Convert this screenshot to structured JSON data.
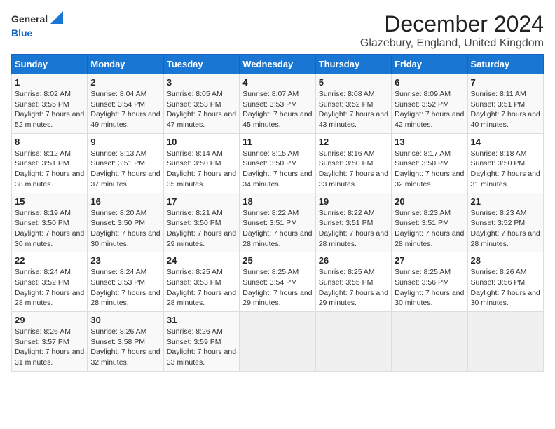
{
  "header": {
    "logo_general": "General",
    "logo_blue": "Blue",
    "title": "December 2024",
    "subtitle": "Glazebury, England, United Kingdom"
  },
  "calendar": {
    "columns": [
      "Sunday",
      "Monday",
      "Tuesday",
      "Wednesday",
      "Thursday",
      "Friday",
      "Saturday"
    ],
    "rows": [
      [
        {
          "day": "1",
          "sunrise": "Sunrise: 8:02 AM",
          "sunset": "Sunset: 3:55 PM",
          "daylight": "Daylight: 7 hours and 52 minutes."
        },
        {
          "day": "2",
          "sunrise": "Sunrise: 8:04 AM",
          "sunset": "Sunset: 3:54 PM",
          "daylight": "Daylight: 7 hours and 49 minutes."
        },
        {
          "day": "3",
          "sunrise": "Sunrise: 8:05 AM",
          "sunset": "Sunset: 3:53 PM",
          "daylight": "Daylight: 7 hours and 47 minutes."
        },
        {
          "day": "4",
          "sunrise": "Sunrise: 8:07 AM",
          "sunset": "Sunset: 3:53 PM",
          "daylight": "Daylight: 7 hours and 45 minutes."
        },
        {
          "day": "5",
          "sunrise": "Sunrise: 8:08 AM",
          "sunset": "Sunset: 3:52 PM",
          "daylight": "Daylight: 7 hours and 43 minutes."
        },
        {
          "day": "6",
          "sunrise": "Sunrise: 8:09 AM",
          "sunset": "Sunset: 3:52 PM",
          "daylight": "Daylight: 7 hours and 42 minutes."
        },
        {
          "day": "7",
          "sunrise": "Sunrise: 8:11 AM",
          "sunset": "Sunset: 3:51 PM",
          "daylight": "Daylight: 7 hours and 40 minutes."
        }
      ],
      [
        {
          "day": "8",
          "sunrise": "Sunrise: 8:12 AM",
          "sunset": "Sunset: 3:51 PM",
          "daylight": "Daylight: 7 hours and 38 minutes."
        },
        {
          "day": "9",
          "sunrise": "Sunrise: 8:13 AM",
          "sunset": "Sunset: 3:51 PM",
          "daylight": "Daylight: 7 hours and 37 minutes."
        },
        {
          "day": "10",
          "sunrise": "Sunrise: 8:14 AM",
          "sunset": "Sunset: 3:50 PM",
          "daylight": "Daylight: 7 hours and 35 minutes."
        },
        {
          "day": "11",
          "sunrise": "Sunrise: 8:15 AM",
          "sunset": "Sunset: 3:50 PM",
          "daylight": "Daylight: 7 hours and 34 minutes."
        },
        {
          "day": "12",
          "sunrise": "Sunrise: 8:16 AM",
          "sunset": "Sunset: 3:50 PM",
          "daylight": "Daylight: 7 hours and 33 minutes."
        },
        {
          "day": "13",
          "sunrise": "Sunrise: 8:17 AM",
          "sunset": "Sunset: 3:50 PM",
          "daylight": "Daylight: 7 hours and 32 minutes."
        },
        {
          "day": "14",
          "sunrise": "Sunrise: 8:18 AM",
          "sunset": "Sunset: 3:50 PM",
          "daylight": "Daylight: 7 hours and 31 minutes."
        }
      ],
      [
        {
          "day": "15",
          "sunrise": "Sunrise: 8:19 AM",
          "sunset": "Sunset: 3:50 PM",
          "daylight": "Daylight: 7 hours and 30 minutes."
        },
        {
          "day": "16",
          "sunrise": "Sunrise: 8:20 AM",
          "sunset": "Sunset: 3:50 PM",
          "daylight": "Daylight: 7 hours and 30 minutes."
        },
        {
          "day": "17",
          "sunrise": "Sunrise: 8:21 AM",
          "sunset": "Sunset: 3:50 PM",
          "daylight": "Daylight: 7 hours and 29 minutes."
        },
        {
          "day": "18",
          "sunrise": "Sunrise: 8:22 AM",
          "sunset": "Sunset: 3:51 PM",
          "daylight": "Daylight: 7 hours and 28 minutes."
        },
        {
          "day": "19",
          "sunrise": "Sunrise: 8:22 AM",
          "sunset": "Sunset: 3:51 PM",
          "daylight": "Daylight: 7 hours and 28 minutes."
        },
        {
          "day": "20",
          "sunrise": "Sunrise: 8:23 AM",
          "sunset": "Sunset: 3:51 PM",
          "daylight": "Daylight: 7 hours and 28 minutes."
        },
        {
          "day": "21",
          "sunrise": "Sunrise: 8:23 AM",
          "sunset": "Sunset: 3:52 PM",
          "daylight": "Daylight: 7 hours and 28 minutes."
        }
      ],
      [
        {
          "day": "22",
          "sunrise": "Sunrise: 8:24 AM",
          "sunset": "Sunset: 3:52 PM",
          "daylight": "Daylight: 7 hours and 28 minutes."
        },
        {
          "day": "23",
          "sunrise": "Sunrise: 8:24 AM",
          "sunset": "Sunset: 3:53 PM",
          "daylight": "Daylight: 7 hours and 28 minutes."
        },
        {
          "day": "24",
          "sunrise": "Sunrise: 8:25 AM",
          "sunset": "Sunset: 3:53 PM",
          "daylight": "Daylight: 7 hours and 28 minutes."
        },
        {
          "day": "25",
          "sunrise": "Sunrise: 8:25 AM",
          "sunset": "Sunset: 3:54 PM",
          "daylight": "Daylight: 7 hours and 29 minutes."
        },
        {
          "day": "26",
          "sunrise": "Sunrise: 8:25 AM",
          "sunset": "Sunset: 3:55 PM",
          "daylight": "Daylight: 7 hours and 29 minutes."
        },
        {
          "day": "27",
          "sunrise": "Sunrise: 8:25 AM",
          "sunset": "Sunset: 3:56 PM",
          "daylight": "Daylight: 7 hours and 30 minutes."
        },
        {
          "day": "28",
          "sunrise": "Sunrise: 8:26 AM",
          "sunset": "Sunset: 3:56 PM",
          "daylight": "Daylight: 7 hours and 30 minutes."
        }
      ],
      [
        {
          "day": "29",
          "sunrise": "Sunrise: 8:26 AM",
          "sunset": "Sunset: 3:57 PM",
          "daylight": "Daylight: 7 hours and 31 minutes."
        },
        {
          "day": "30",
          "sunrise": "Sunrise: 8:26 AM",
          "sunset": "Sunset: 3:58 PM",
          "daylight": "Daylight: 7 hours and 32 minutes."
        },
        {
          "day": "31",
          "sunrise": "Sunrise: 8:26 AM",
          "sunset": "Sunset: 3:59 PM",
          "daylight": "Daylight: 7 hours and 33 minutes."
        },
        null,
        null,
        null,
        null
      ]
    ]
  }
}
